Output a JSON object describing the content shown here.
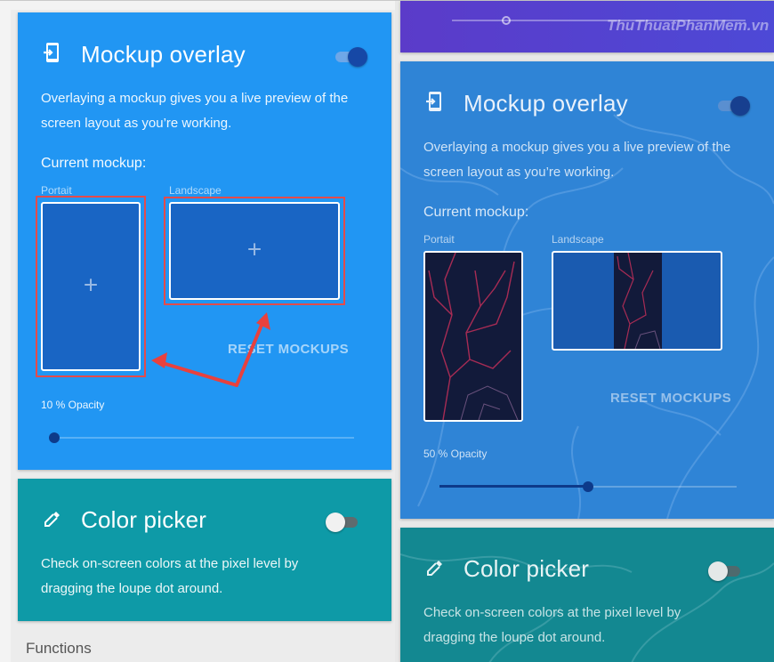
{
  "left_panel": {
    "mockup_card": {
      "title": "Mockup overlay",
      "description_line1": "Overlaying a mockup gives you a live preview of the",
      "description_line2": "screen layout as you’re working.",
      "current_mockup_label": "Current mockup:",
      "portrait_label": "Portait",
      "landscape_label": "Landscape",
      "add_symbol": "+",
      "reset_label": "RESET MOCKUPS",
      "opacity_label": "10 % Opacity",
      "opacity_value": 0.1,
      "toggle_on": true,
      "icon": "phone-import-icon"
    },
    "picker_card": {
      "title": "Color picker",
      "description_line1": "Check on-screen colors at the pixel level by",
      "description_line2": "dragging the loupe dot around.",
      "toggle_on": false,
      "icon": "eyedropper-icon"
    },
    "section_label": "Functions"
  },
  "right_panel": {
    "watermark": "ThuThuatPhanMem.vn",
    "mockup_card": {
      "title": "Mockup overlay",
      "description_line1": "Overlaying a mockup gives you a live preview of the",
      "description_line2": "screen layout as you’re working.",
      "current_mockup_label": "Current mockup:",
      "portrait_label": "Portait",
      "landscape_label": "Landscape",
      "reset_label": "RESET MOCKUPS",
      "opacity_label": "50 % Opacity",
      "opacity_value": 0.5,
      "toggle_on": true,
      "icon": "phone-import-icon"
    },
    "picker_card": {
      "title": "Color picker",
      "description_line1": "Check on-screen colors at the pixel level by",
      "description_line2": "dragging the loupe dot around.",
      "toggle_on": false,
      "icon": "eyedropper-icon"
    }
  },
  "colors": {
    "mockup_card": "#2196f3",
    "picker_card": "#0e9aa7",
    "highlight": "#e44b4b",
    "accent_dark": "#1648a6"
  }
}
